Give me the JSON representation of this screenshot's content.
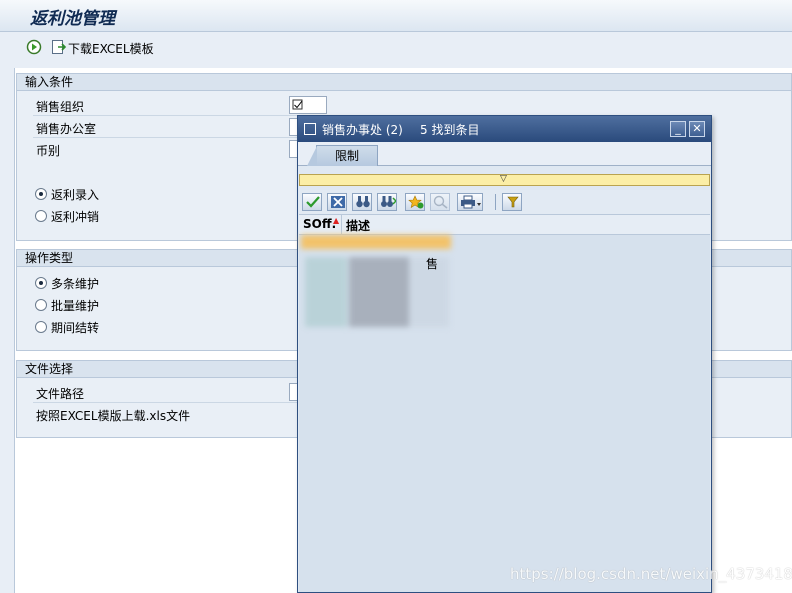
{
  "app": {
    "title": "返利池管理"
  },
  "toolbar": {
    "execute_icon": "execute-icon",
    "download_label": "下载EXCEL模板"
  },
  "input_conditions": {
    "header": "输入条件",
    "fields": [
      {
        "label": "销售组织",
        "value": ""
      },
      {
        "label": "销售办公室",
        "value": ""
      },
      {
        "label": "币别",
        "value": ""
      }
    ],
    "radios": [
      {
        "label": "返利录入",
        "selected": true
      },
      {
        "label": "返利冲销",
        "selected": false
      }
    ]
  },
  "operation_type": {
    "header": "操作类型",
    "radios": [
      {
        "label": "多条维护",
        "selected": true
      },
      {
        "label": "批量维护",
        "selected": false
      },
      {
        "label": "期间结转",
        "selected": false
      }
    ]
  },
  "file_select": {
    "header": "文件选择",
    "path_label": "文件路径",
    "path_value": "",
    "hint": "按照EXCEL模版上载.xls文件"
  },
  "popup": {
    "title": "销售办事处 (2)",
    "count_text": "5 找到条目",
    "tab_label": "限制",
    "grid": {
      "columns": [
        "SOff.",
        "描述"
      ],
      "visible_fragments": [
        "售"
      ]
    }
  },
  "watermark": "https://blog.csdn.net/weixin_43734184",
  "colors": {
    "popup_header": "#2a4a7c",
    "collapse_bar": "#fbeea6",
    "background": "#e8eef6"
  }
}
